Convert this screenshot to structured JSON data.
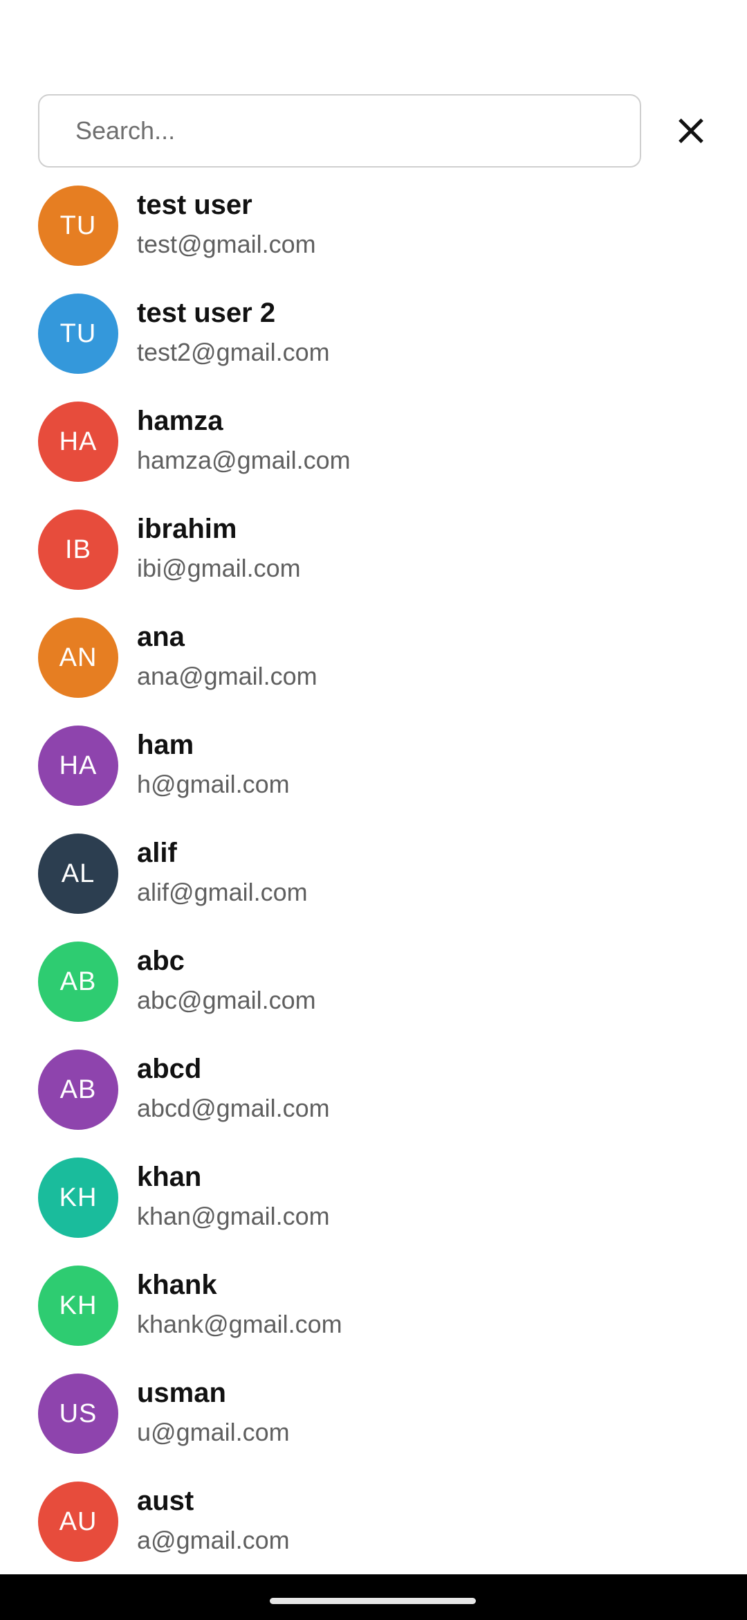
{
  "search": {
    "placeholder": "Search...",
    "value": ""
  },
  "icons": {
    "close": "close-icon"
  },
  "users": [
    {
      "initials": "TU",
      "name": "test user",
      "email": "test@gmail.com",
      "color": "#E67E22"
    },
    {
      "initials": "TU",
      "name": "test user 2",
      "email": "test2@gmail.com",
      "color": "#3498DB"
    },
    {
      "initials": "HA",
      "name": "hamza",
      "email": "hamza@gmail.com",
      "color": "#E74C3C"
    },
    {
      "initials": "IB",
      "name": "ibrahim",
      "email": "ibi@gmail.com",
      "color": "#E74C3C"
    },
    {
      "initials": "AN",
      "name": "ana",
      "email": "ana@gmail.com",
      "color": "#E67E22"
    },
    {
      "initials": "HA",
      "name": "ham",
      "email": "h@gmail.com",
      "color": "#8E44AD"
    },
    {
      "initials": "AL",
      "name": "alif",
      "email": "alif@gmail.com",
      "color": "#2C3E50"
    },
    {
      "initials": "AB",
      "name": "abc",
      "email": "abc@gmail.com",
      "color": "#2ECC71"
    },
    {
      "initials": "AB",
      "name": "abcd",
      "email": "abcd@gmail.com",
      "color": "#8E44AD"
    },
    {
      "initials": "KH",
      "name": "khan",
      "email": "khan@gmail.com",
      "color": "#1ABC9C"
    },
    {
      "initials": "KH",
      "name": "khank",
      "email": "khank@gmail.com",
      "color": "#2ECC71"
    },
    {
      "initials": "US",
      "name": "usman",
      "email": "u@gmail.com",
      "color": "#8E44AD"
    },
    {
      "initials": "AU",
      "name": "aust",
      "email": "a@gmail.com",
      "color": "#E74C3C"
    }
  ]
}
